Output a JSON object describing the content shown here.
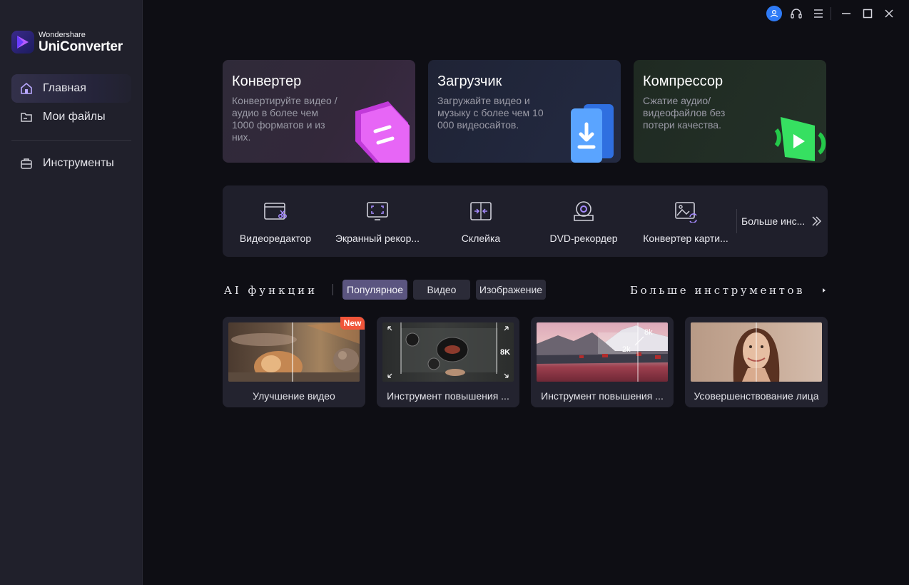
{
  "app": {
    "brand_small": "Wondershare",
    "brand_big": "UniConverter"
  },
  "sidebar": {
    "items": [
      {
        "label": "Главная",
        "icon": "home-icon",
        "active": true
      },
      {
        "label": "Мои файлы",
        "icon": "folder-icon",
        "active": false
      },
      {
        "label": "Инструменты",
        "icon": "toolbox-icon",
        "active": false
      }
    ]
  },
  "topbar": {
    "icons": [
      "user-avatar-icon",
      "headset-icon",
      "menu-icon",
      "minimize-icon",
      "maximize-icon",
      "close-icon"
    ]
  },
  "feature_cards": [
    {
      "title": "Конвертер",
      "desc": "Конвертируйте видео / аудио в более чем 1000 форматов и из них.",
      "icon": "convert-icon"
    },
    {
      "title": "Загрузчик",
      "desc": "Загружайте видео и музыку с более чем 10 000 видеосайтов.",
      "icon": "download-icon"
    },
    {
      "title": "Компрессор",
      "desc": "Сжатие аудио/ видеофайлов без потери качества.",
      "icon": "compress-icon"
    }
  ],
  "tools": {
    "items": [
      {
        "label": "Видеоредактор",
        "icon": "video-editor-icon"
      },
      {
        "label": "Экранный рекор...",
        "icon": "screen-recorder-icon"
      },
      {
        "label": "Склейка",
        "icon": "merge-icon"
      },
      {
        "label": "DVD-рекордер",
        "icon": "dvd-icon"
      },
      {
        "label": "Конвертер карти...",
        "icon": "image-converter-icon"
      }
    ],
    "more_label": "Больше инс..."
  },
  "ai": {
    "title": "AI функции",
    "tabs": [
      {
        "label": "Популярное",
        "active": true
      },
      {
        "label": "Видео",
        "active": false
      },
      {
        "label": "Изображение",
        "active": false
      }
    ],
    "more_label": "Больше инструментов",
    "cards": [
      {
        "label": "Улучшение видео",
        "badge": "New"
      },
      {
        "label": "Инструмент повышения ...",
        "overlay": "8K"
      },
      {
        "label": "Инструмент повышения ...",
        "overlay_a": "8k",
        "overlay_b": "2k"
      },
      {
        "label": "Усовершенствование лица"
      }
    ]
  },
  "colors": {
    "accent_blue": "#2f7bf6",
    "badge_red": "#f0553a",
    "active_tab": "#5b5580"
  }
}
